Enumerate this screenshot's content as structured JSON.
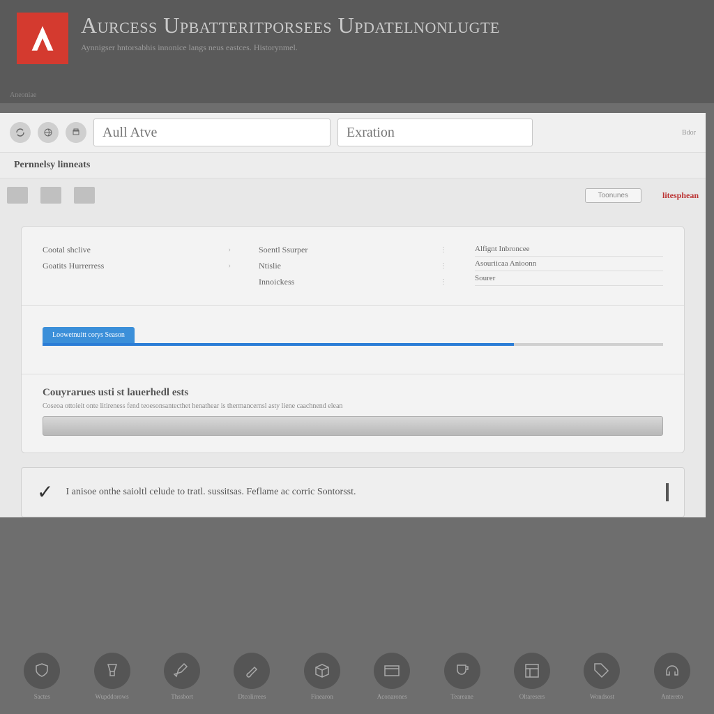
{
  "header": {
    "title": "Aurcess Upbatteritporsees Updatelnonlugte",
    "subtitle": "Aynnigser hntorsabhis innonice langs neus eastces. Historynmel.",
    "breadcrumb": "Aneoniae"
  },
  "toolbar": {
    "search1_placeholder": "Aull Atve",
    "search2_placeholder": "Exration",
    "badge": "Bdor"
  },
  "section_title": "Pernnelsy linneats",
  "tabs": {
    "button_label": "Toonunes",
    "link": "litesphean"
  },
  "panel": {
    "left": [
      "Cootal shclive",
      "Goatits Hurrerress"
    ],
    "mid": [
      "Soentl Ssurper",
      "Ntislie",
      "Innoickess"
    ],
    "right": [
      "Alfignt Inbroncee",
      "Asouriicaa Anioonn",
      "Sourer"
    ],
    "progress_label": "Loowetnuitt corys Season",
    "progress_percent": 76,
    "desc_title": "Couyrarues usti st lauerhedl ests",
    "desc_body": "Coseoa ottoieit onte litireness fend teoesonsantecthet henathear is thermancernsl asty liene caachnend elean"
  },
  "banner": {
    "message": "I anisoe onthe saioltl celude to tratl. sussitsas. Feflame ac corric Sontorsst."
  },
  "footer": [
    {
      "name": "shield-icon",
      "label": "Sactes"
    },
    {
      "name": "glass-icon",
      "label": "Wupddorows"
    },
    {
      "name": "pen-icon",
      "label": "Thssbort"
    },
    {
      "name": "brush-icon",
      "label": "Dtcolirrees"
    },
    {
      "name": "box-icon",
      "label": "Finearon"
    },
    {
      "name": "card-icon",
      "label": "Aconarones"
    },
    {
      "name": "cup-icon",
      "label": "Teareane"
    },
    {
      "name": "panel-icon",
      "label": "Oltaresers"
    },
    {
      "name": "tag-icon",
      "label": "Wondsost"
    },
    {
      "name": "headset-icon",
      "label": "Antereto"
    }
  ]
}
